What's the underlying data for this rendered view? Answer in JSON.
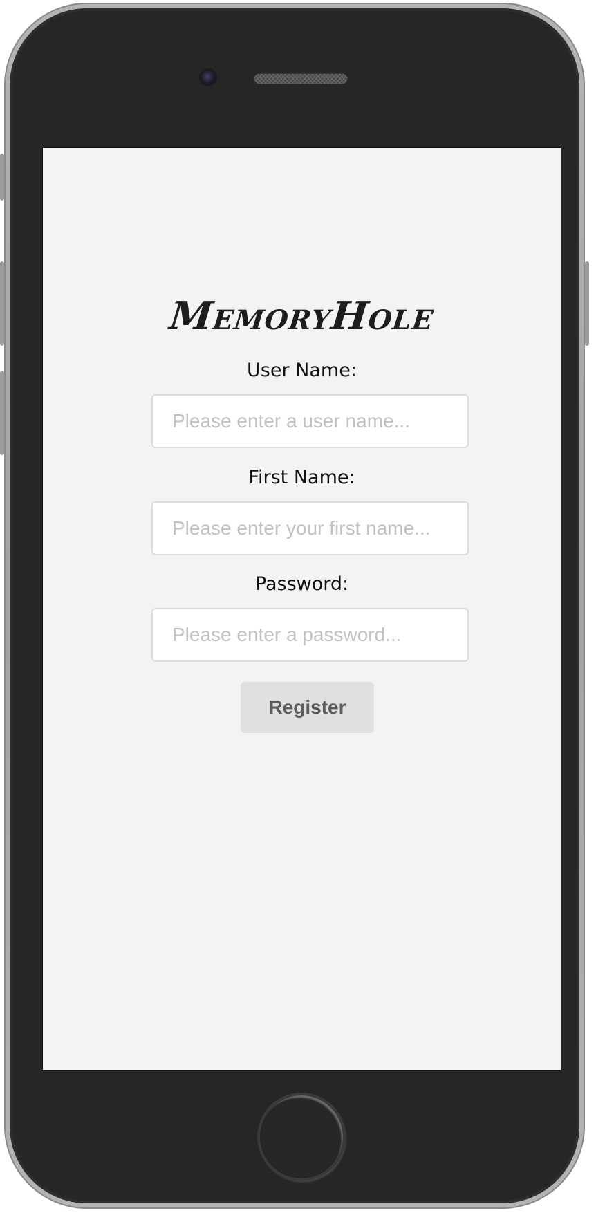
{
  "app": {
    "title": "MemoryHole"
  },
  "form": {
    "username": {
      "label": "User Name:",
      "placeholder": "Please enter a user name...",
      "value": ""
    },
    "firstname": {
      "label": "First Name:",
      "placeholder": "Please enter your first name...",
      "value": ""
    },
    "password": {
      "label": "Password:",
      "placeholder": "Please enter a password...",
      "value": ""
    },
    "submit_label": "Register"
  },
  "colors": {
    "screen_background": "#f3f3f3",
    "phone_body": "#262626",
    "button_background": "#dfe0e1",
    "button_text": "#5b5b5b",
    "placeholder_text": "#c2c2c2"
  }
}
